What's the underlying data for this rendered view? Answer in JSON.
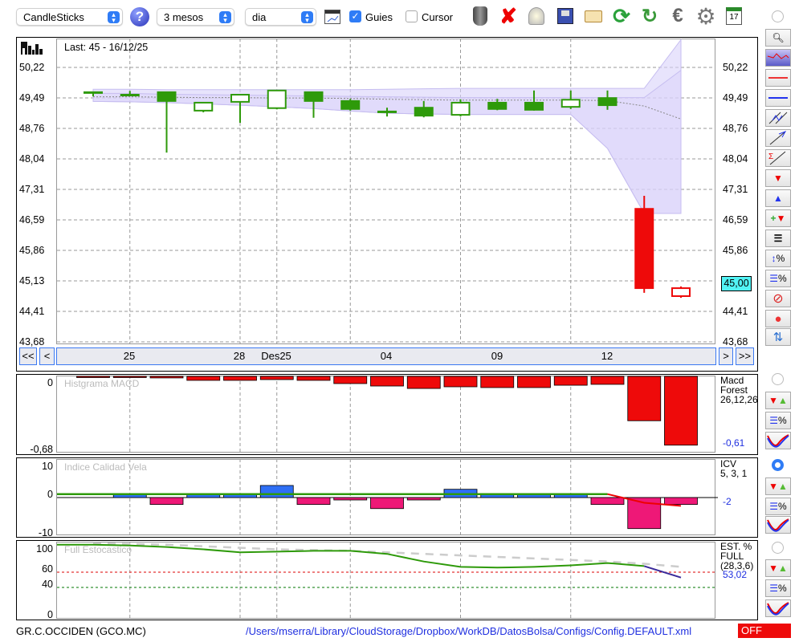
{
  "toolbar": {
    "chart_type": "CandleSticks",
    "period": "3 mesos",
    "interval": "dia",
    "guies_label": "Guies",
    "guies_checked": true,
    "cursor_label": "Cursor",
    "cursor_checked": false,
    "icons": [
      "help-icon",
      "chart-window-icon",
      "trash-icon",
      "delete-icon",
      "lamp-icon",
      "save-icon",
      "folder-open-icon",
      "refresh-icon",
      "refresh-alt-icon",
      "euro-icon",
      "gear-icon",
      "calendar-icon"
    ],
    "calendar_day": "17"
  },
  "main": {
    "last_label": "Last: 45 - 16/12/25",
    "y_ticks": [
      "50,22",
      "49,49",
      "48,76",
      "48,04",
      "47,31",
      "46,59",
      "45,86",
      "45,13",
      "44,41",
      "43,68"
    ],
    "current_price": "45,00",
    "current_price_bg": "#52f3f5",
    "x_labels": [
      "25",
      "28",
      "Des25",
      "04",
      "09",
      "12"
    ],
    "nav": {
      "first": "<<",
      "prev": "<",
      "next": ">",
      "last": ">>"
    }
  },
  "macd": {
    "title": "Histgrama MACD",
    "y_top": "0",
    "y_bottom": "-0,68",
    "name": "Macd\nForest\n26,12,26",
    "value": "-0,61"
  },
  "icv": {
    "title": "Indice Calidad Vela",
    "y_top": "10",
    "y_mid": "0",
    "y_bottom": "-10",
    "name": "ICV\n5, 3, 1",
    "value": "-2"
  },
  "stoch": {
    "title": "Full Estocastico",
    "y_100": "100",
    "y_60": "60",
    "y_40": "40",
    "y_0": "0",
    "name": "EST. %\nFULL\n(28,3,6)",
    "value": "53,02"
  },
  "status": {
    "ticker": "GR.C.OCCIDEN (GCO.MC)",
    "config_path": "/Users/mserra/Library/CloudStorage/Dropbox/WorkDB/DatosBolsa/Configs/Config.DEFAULT.xml",
    "mode": "OFF"
  },
  "colors": {
    "up": "#2e9a0a",
    "down": "#ee0a0a",
    "band": "#d9d2fa",
    "macd": "#ee0a0a",
    "icv_pos": "#2f6ff5",
    "icv_neg": "#ee1877",
    "stoch_k": "#2e9a0a"
  },
  "chart_data": [
    {
      "type": "candlestick",
      "title": "CandleSticks",
      "ylim": [
        43.68,
        50.22
      ],
      "x_gridlines_at_index": [
        1,
        4,
        5,
        7,
        10,
        13
      ],
      "candles": [
        {
          "o": 49.63,
          "h": 49.63,
          "l": 49.53,
          "c": 49.63,
          "filled": false,
          "color": "up"
        },
        {
          "o": 49.57,
          "h": 49.66,
          "l": 49.55,
          "c": 49.57,
          "filled": false,
          "color": "up"
        },
        {
          "o": 49.63,
          "h": 49.63,
          "l": 48.19,
          "c": 49.42,
          "filled": true,
          "color": "up"
        },
        {
          "o": 49.19,
          "h": 49.38,
          "l": 49.15,
          "c": 49.38,
          "filled": false,
          "color": "up"
        },
        {
          "o": 49.4,
          "h": 49.57,
          "l": 48.9,
          "c": 49.57,
          "filled": false,
          "color": "up"
        },
        {
          "o": 49.25,
          "h": 49.67,
          "l": 49.22,
          "c": 49.67,
          "filled": false,
          "color": "up"
        },
        {
          "o": 49.63,
          "h": 49.63,
          "l": 49.02,
          "c": 49.42,
          "filled": true,
          "color": "up"
        },
        {
          "o": 49.42,
          "h": 49.47,
          "l": 49.19,
          "c": 49.23,
          "filled": true,
          "color": "up"
        },
        {
          "o": 49.17,
          "h": 49.26,
          "l": 49.05,
          "c": 49.17,
          "filled": false,
          "color": "up"
        },
        {
          "o": 49.26,
          "h": 49.42,
          "l": 49.03,
          "c": 49.07,
          "filled": true,
          "color": "up"
        },
        {
          "o": 49.09,
          "h": 49.46,
          "l": 49.05,
          "c": 49.38,
          "filled": false,
          "color": "up"
        },
        {
          "o": 49.38,
          "h": 49.47,
          "l": 49.2,
          "c": 49.23,
          "filled": true,
          "color": "up"
        },
        {
          "o": 49.38,
          "h": 49.67,
          "l": 49.19,
          "c": 49.21,
          "filled": true,
          "color": "up"
        },
        {
          "o": 49.28,
          "h": 49.67,
          "l": 49.23,
          "c": 49.45,
          "filled": false,
          "color": "up"
        },
        {
          "o": 49.49,
          "h": 49.67,
          "l": 49.21,
          "c": 49.32,
          "filled": true,
          "color": "up"
        },
        {
          "o": 46.85,
          "h": 47.16,
          "l": 44.85,
          "c": 44.96,
          "filled": true,
          "color": "down"
        },
        {
          "o": 44.77,
          "h": 45.0,
          "l": 44.73,
          "c": 44.96,
          "filled": false,
          "color": "down"
        }
      ],
      "band_upper": [
        49.7,
        49.7,
        49.69,
        49.69,
        49.69,
        49.69,
        49.69,
        49.69,
        49.7,
        49.71,
        49.72,
        49.72,
        49.72,
        49.72,
        49.72,
        49.72,
        50.88
      ],
      "band_inner_upper": [
        49.6,
        49.6,
        49.58,
        49.57,
        49.56,
        49.55,
        49.54,
        49.53,
        49.52,
        49.51,
        49.5,
        49.5,
        49.5,
        49.5,
        49.5,
        49.5,
        50.15
      ],
      "band_middle": [
        49.52,
        49.52,
        49.51,
        49.5,
        49.5,
        49.49,
        49.49,
        49.48,
        49.46,
        49.45,
        49.44,
        49.44,
        49.44,
        49.44,
        49.43,
        49.3,
        48.99
      ],
      "band_lower": [
        49.41,
        49.4,
        49.38,
        49.35,
        49.32,
        49.28,
        49.24,
        49.18,
        49.13,
        49.11,
        49.1,
        49.1,
        49.1,
        49.1,
        48.29,
        46.74,
        46.74
      ]
    },
    {
      "type": "bar",
      "title": "Histgrama MACD",
      "ylim": [
        -0.68,
        0
      ],
      "values": [
        -0.005,
        -0.005,
        -0.014,
        -0.036,
        -0.036,
        -0.029,
        -0.036,
        -0.065,
        -0.087,
        -0.109,
        -0.094,
        -0.101,
        -0.101,
        -0.08,
        -0.072,
        -0.4,
        -0.62
      ]
    },
    {
      "type": "bar",
      "title": "Indice Calidad Vela",
      "ylim": [
        -10,
        10
      ],
      "values": [
        0,
        1,
        -2,
        1,
        1,
        3.5,
        -2,
        -0.7,
        -3.2,
        -0.7,
        2.4,
        1,
        1,
        1,
        -2,
        -9,
        -2
      ],
      "line": [
        1,
        1,
        1,
        1,
        1,
        1,
        1,
        1,
        1,
        1,
        1,
        1,
        1,
        1,
        1,
        -1.5,
        -2.4
      ]
    },
    {
      "type": "line",
      "title": "Full Estocastico",
      "ylim": [
        0,
        100
      ],
      "levels": [
        60,
        40
      ],
      "k": [
        96,
        95,
        93,
        90,
        86,
        87,
        88,
        88,
        84,
        74,
        67,
        66,
        67,
        69,
        72,
        68,
        53
      ],
      "d": [
        98,
        97,
        96,
        94,
        92,
        90,
        89,
        88,
        86,
        84,
        82,
        80,
        78,
        76,
        74,
        71,
        67
      ]
    }
  ]
}
